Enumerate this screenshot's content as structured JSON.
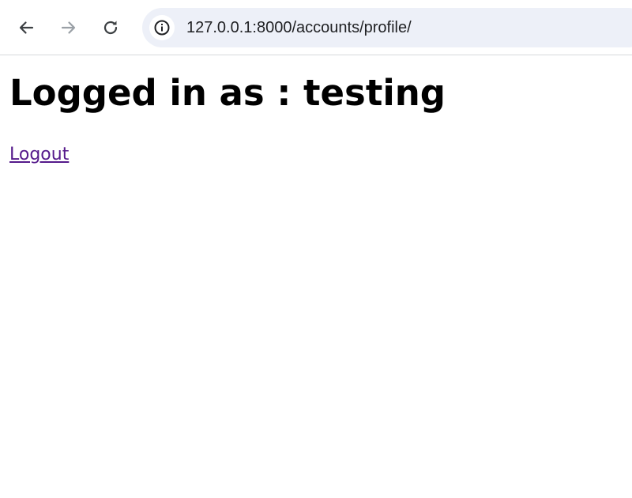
{
  "browser": {
    "url": "127.0.0.1:8000/accounts/profile/",
    "icons": {
      "back": "arrow-left-icon",
      "forward": "arrow-right-icon",
      "reload": "reload-icon",
      "site_info": "info-icon"
    },
    "colors": {
      "omnibox_bg": "#edf0f8",
      "icon_active": "#3c4043",
      "icon_disabled": "#9aa0a6"
    }
  },
  "page": {
    "heading": "Logged in as : testing",
    "logout_label": "Logout",
    "colors": {
      "link_visited": "#551a8b"
    }
  }
}
